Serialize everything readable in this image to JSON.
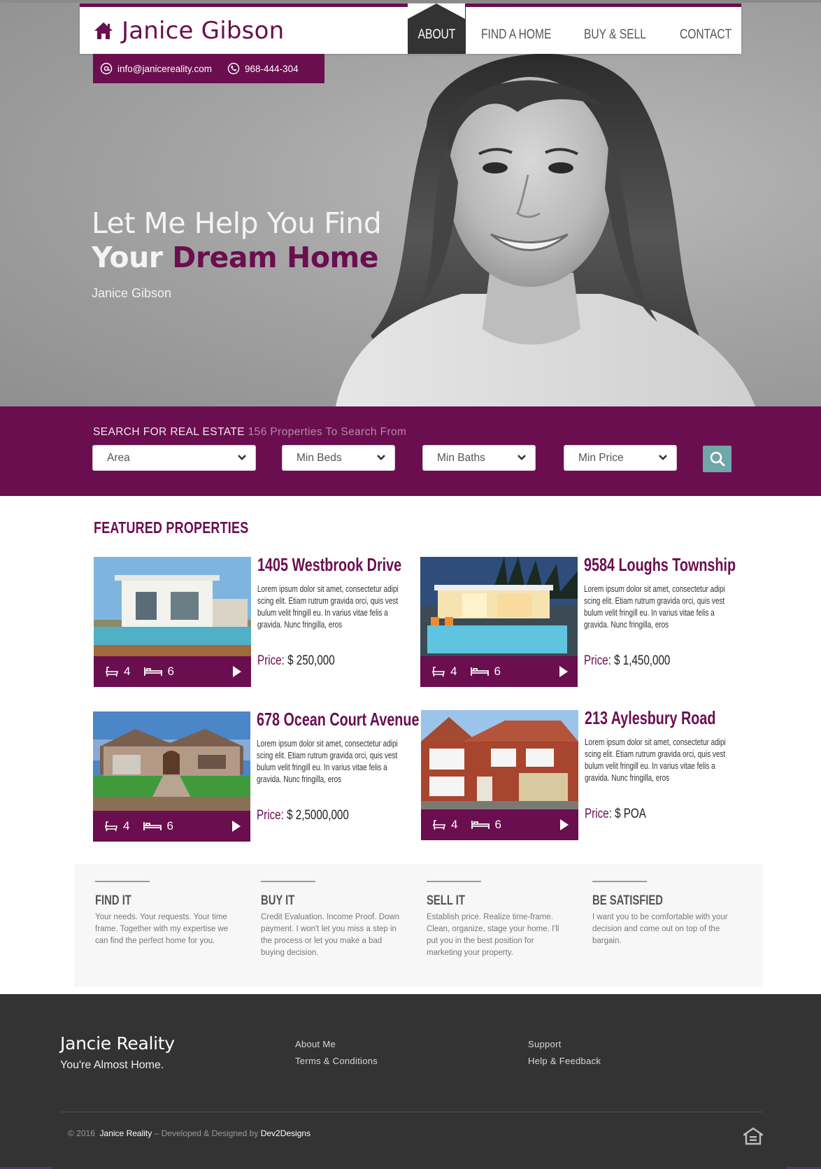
{
  "header": {
    "brand_name": "Janice Gibson",
    "nav": [
      {
        "label": "ABOUT",
        "active": true
      },
      {
        "label": "FIND A HOME"
      },
      {
        "label": "BUY & SELL"
      },
      {
        "label": "CONTACT"
      }
    ]
  },
  "contact": {
    "email": "info@janicereality.com",
    "phone": "968-444-304"
  },
  "hero": {
    "line1": "Let Me Help You Find",
    "line2_prefix": "Your",
    "line2_accent": "Dream Home",
    "subtitle": "Janice Gibson"
  },
  "search": {
    "title": "SEARCH FOR REAL ESTATE",
    "count_text": "156 Properties To Search From",
    "selects": {
      "area": "Area",
      "beds": "Min Beds",
      "baths": "Min Baths",
      "price": "Min Price"
    }
  },
  "featured": {
    "title": "FEATURED PROPERTIES",
    "price_label": "Price:",
    "properties": [
      {
        "name": "1405 Westbrook Drive",
        "desc": "Lorem ipsum dolor sit amet, consectetur adipi scing elit. Etiam rutrum gravida orci, quis vest bulum velit fringill eu. In varius vitae felis a gravida. Nunc fringilla, eros",
        "price": "$ 250,000",
        "baths": "4",
        "beds": "6"
      },
      {
        "name": "9584 Loughs Township",
        "desc": "Lorem ipsum dolor sit amet, consectetur adipi scing elit. Etiam rutrum gravida orci, quis vest bulum velit fringill eu. In varius vitae felis a gravida. Nunc fringilla, eros",
        "price": "$ 1,450,000",
        "baths": "4",
        "beds": "6"
      },
      {
        "name": "678 Ocean Court Avenue",
        "desc": "Lorem ipsum dolor sit amet, consectetur adipi scing elit. Etiam rutrum gravida orci, quis vest bulum velit fringill eu. In varius vitae felis a gravida. Nunc fringilla, eros",
        "price": "$ 2,5000,000",
        "baths": "4",
        "beds": "6"
      },
      {
        "name": "213 Aylesbury Road",
        "desc": "Lorem ipsum dolor sit amet, consectetur adipi scing elit. Etiam rutrum gravida orci, quis vest bulum velit fringill eu. In varius vitae felis a gravida. Nunc fringilla, eros",
        "price": "$ POA",
        "baths": "4",
        "beds": "6"
      }
    ]
  },
  "steps": [
    {
      "title": "FIND IT",
      "text": "Your needs. Your requests. Your time frame. Together with my expertise we can find the perfect home for you."
    },
    {
      "title": "BUY IT",
      "text": "Credit Evaluation. Income Proof. Down payment. I won't let you miss a step in the process or let you make a bad buying decision."
    },
    {
      "title": "SELL IT",
      "text": "Establish price. Realize time-frame. Clean, organize, stage your home. I'll put you in the best position for marketing your property."
    },
    {
      "title": "BE SATISFIED",
      "text": "I want you to be comfortable with your decision and come out on top of the bargain."
    }
  ],
  "footer": {
    "brand": "Jancie Reality",
    "tagline": "You're Almost Home.",
    "col1": [
      "About Me",
      "Terms & Conditions"
    ],
    "col2": [
      "Support",
      "Help & Feedback"
    ],
    "copy_prefix": "© 2016",
    "copy_brand": "Janice Reality",
    "copy_middle": "– Developed & Designed by",
    "copy_dev": "Dev2Designs"
  },
  "colors": {
    "accent": "#6a0e4f",
    "search_button": "#6fa6a8",
    "footer_bg": "#333333"
  }
}
